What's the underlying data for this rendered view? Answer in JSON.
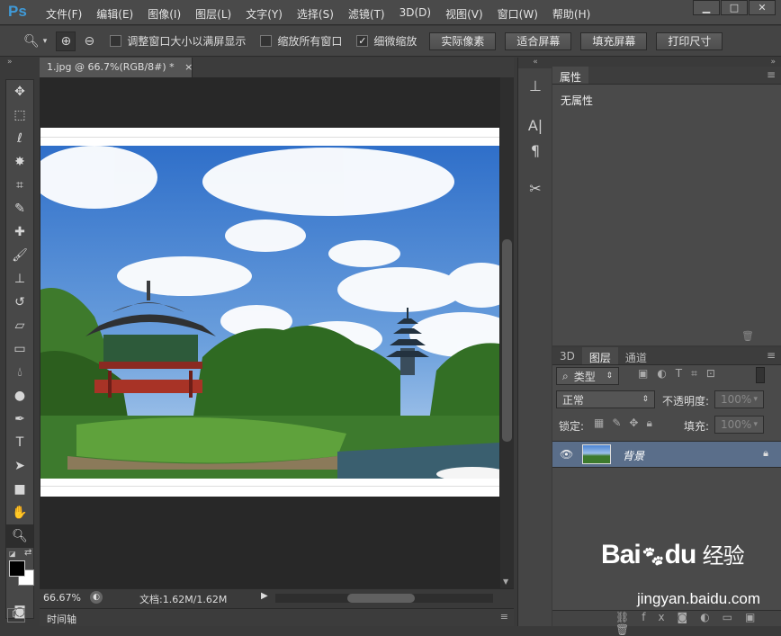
{
  "app": {
    "logo": "Ps"
  },
  "menu": [
    "文件(F)",
    "编辑(E)",
    "图像(I)",
    "图层(L)",
    "文字(Y)",
    "选择(S)",
    "滤镜(T)",
    "3D(D)",
    "视图(V)",
    "窗口(W)",
    "帮助(H)"
  ],
  "options": {
    "resize_windows": "调整窗口大小以满屏显示",
    "zoom_all": "缩放所有窗口",
    "scrubby_zoom": "细微缩放",
    "btn_actual": "实际像素",
    "btn_fit": "适合屏幕",
    "btn_fill": "填充屏幕",
    "btn_print": "打印尺寸"
  },
  "document": {
    "tab_title": "1.jpg @ 66.7%(RGB/8#) *",
    "tab_close": "×"
  },
  "status": {
    "zoom": "66.67%",
    "doc_info": "文档:1.62M/1.62M"
  },
  "timeline": {
    "label": "时间轴"
  },
  "properties": {
    "tab": "属性",
    "content": "无属性"
  },
  "layers": {
    "tabs": [
      "3D",
      "图层",
      "通道"
    ],
    "filter_kind": "类型",
    "blend_mode": "正常",
    "opacity_label": "不透明度:",
    "opacity_value": "100%",
    "lock_label": "锁定:",
    "fill_label": "填充:",
    "fill_value": "100%",
    "layer_name": "背景"
  },
  "watermark": {
    "brand": "Bai",
    "brand2": "du",
    "cn": "经验",
    "url": "jingyan.baidu.com"
  }
}
